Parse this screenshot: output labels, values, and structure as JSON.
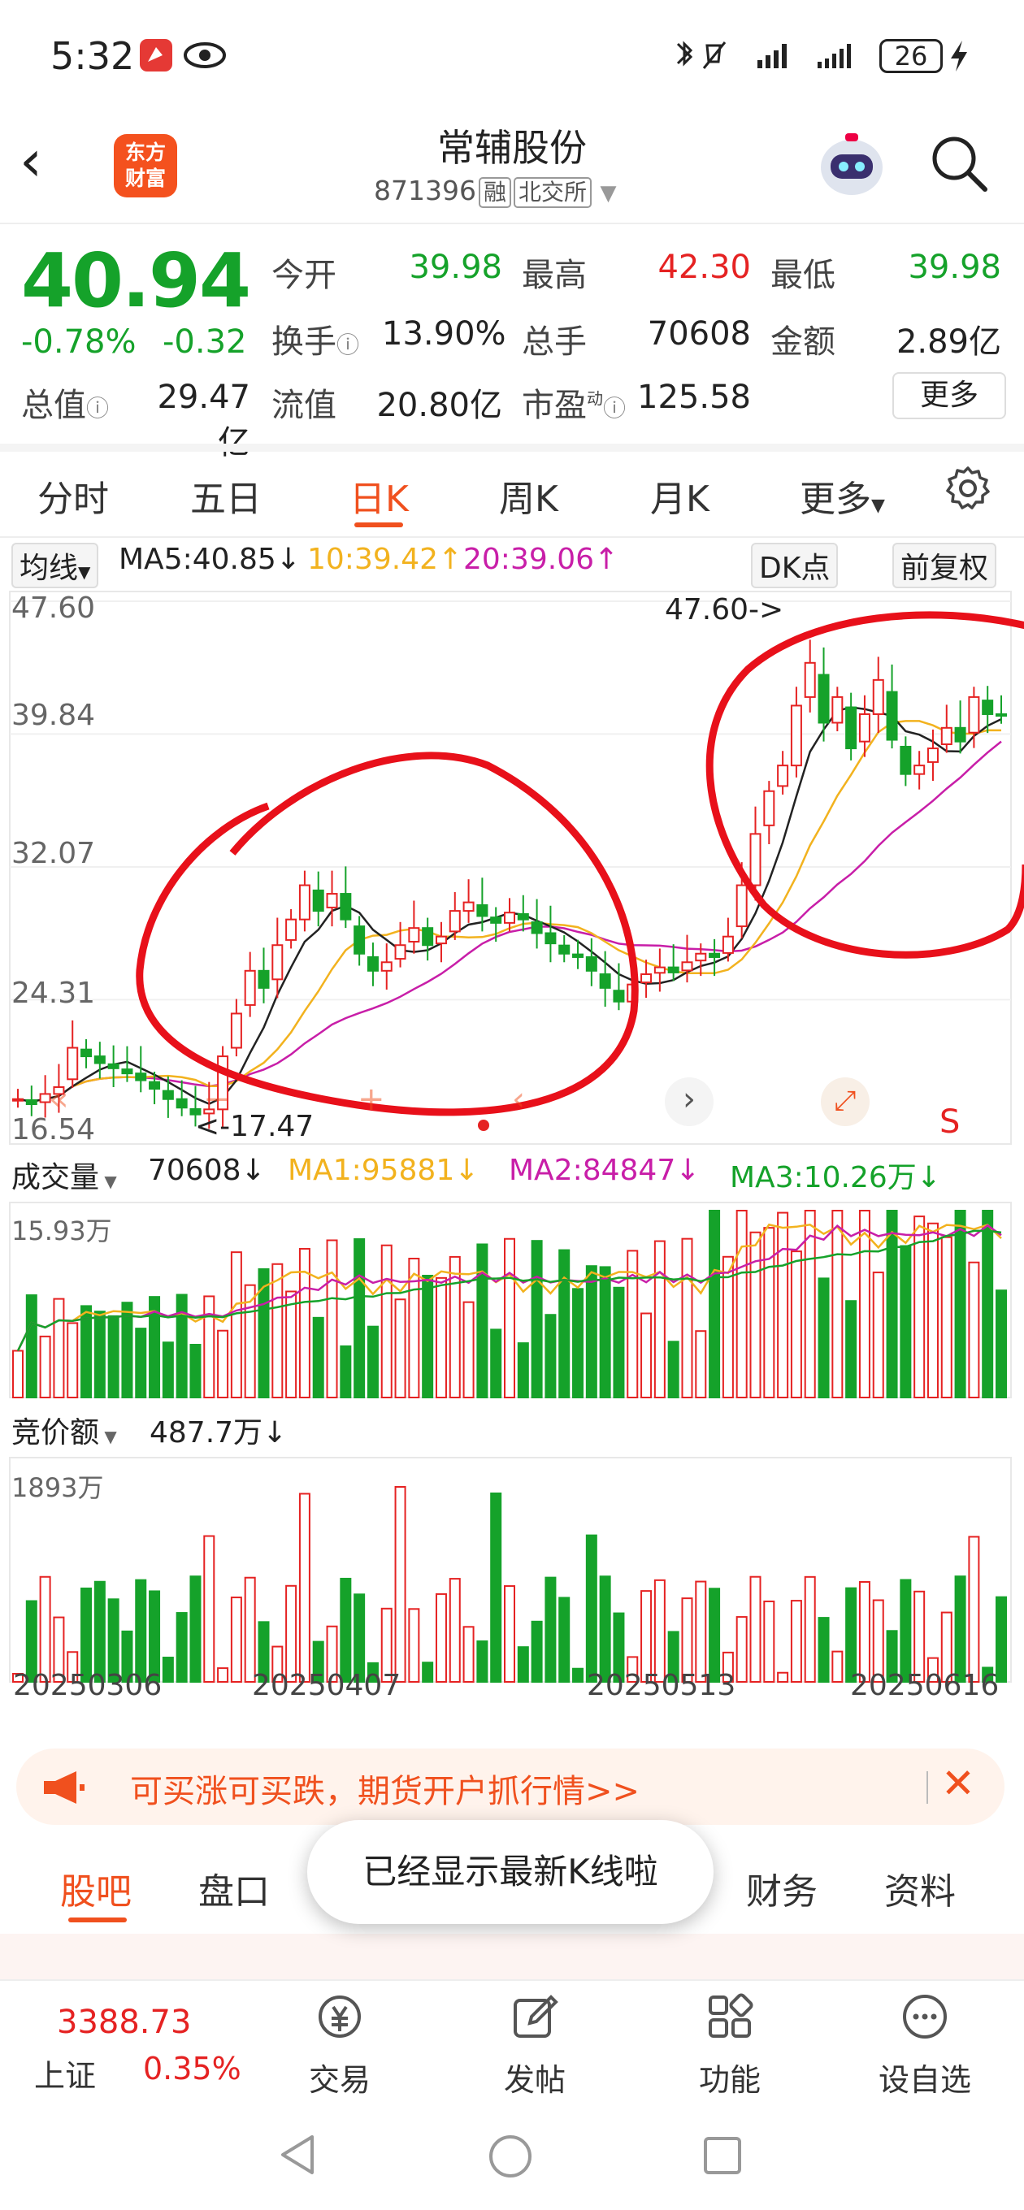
{
  "status": {
    "time": "5:32",
    "battery": "26"
  },
  "header": {
    "logo_line1": "东方",
    "logo_line2": "财富",
    "name": "常辅股份",
    "code": "871396",
    "tag1": "融",
    "tag2": "北交所"
  },
  "quote": {
    "price": "40.94",
    "pct": "-0.78%",
    "change": "-0.32",
    "open_label": "今开",
    "open": "39.98",
    "high_label": "最高",
    "high": "42.30",
    "low_label": "最低",
    "low": "39.98",
    "turnover_label": "换手",
    "turnover": "13.90%",
    "vol_label": "总手",
    "vol": "70608",
    "amount_label": "金额",
    "amount": "2.89亿",
    "mcap_label": "总值",
    "mcap": "29.47亿",
    "float_label": "流值",
    "float": "20.80亿",
    "pe_label": "市盈",
    "pe_sup": "动",
    "pe": "125.58",
    "more": "更多"
  },
  "tabs": {
    "t1": "分时",
    "t2": "五日",
    "t3": "日K",
    "t4": "周K",
    "t5": "月K",
    "t6": "更多"
  },
  "ma": {
    "selector": "均线",
    "ma5": "MA5:40.85↓",
    "ma10": "10:39.42↑",
    "ma20": "20:39.06↑",
    "dk": "DK点",
    "adjust": "前复权"
  },
  "price_axis": {
    "p1": "47.60",
    "p2": "39.84",
    "p3": "32.07",
    "p4": "24.31",
    "p5": "16.54"
  },
  "price_marks": {
    "high": "47.60->",
    "low": "<-17.47"
  },
  "chart_controls": {
    "s": "S"
  },
  "volume": {
    "selector": "成交量",
    "val": "70608↓",
    "ma1": "MA1:95881↓",
    "ma2": "MA2:84847↓",
    "ma3": "MA3:10.26万↓",
    "axis_top": "15.93万"
  },
  "auction": {
    "selector": "竞价额",
    "val": "487.7万↓",
    "axis_top": "1893万"
  },
  "dates": {
    "d1": "20250306",
    "d2": "20250407",
    "d3": "20250513",
    "d4": "20250616"
  },
  "banner": {
    "text": "可买涨可买跌，期货开户抓行情>>"
  },
  "toast": "已经显示最新K线啦",
  "bottom_tabs": {
    "b1": "股吧",
    "b2": "盘口",
    "b3": "财务",
    "b4": "资料"
  },
  "nav": {
    "index_value": "3388.73",
    "index_name": "上证",
    "index_pct": "0.35%",
    "trade": "交易",
    "post": "发帖",
    "func": "功能",
    "watch": "设自选"
  },
  "colors": {
    "up": "#e52222",
    "down": "#15a22a",
    "accent": "#f0501e",
    "ma5": "#222222",
    "ma10": "#f2b21e",
    "ma20": "#c81ea8"
  },
  "chart_data": {
    "type": "candlestick",
    "price_axis_labels": [
      "47.60",
      "39.84",
      "32.07",
      "24.31",
      "16.54"
    ],
    "date_labels": [
      "20250306",
      "20250407",
      "20250513",
      "20250616"
    ],
    "period_high": 47.6,
    "period_low": 17.47,
    "ma5": 40.85,
    "ma10": 39.42,
    "ma20": 39.06,
    "volume_axis_top": "15.93万",
    "auction_axis_top": "1893万"
  }
}
